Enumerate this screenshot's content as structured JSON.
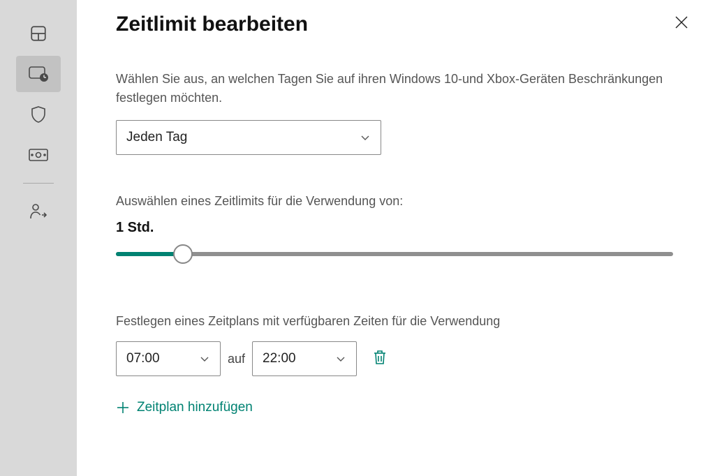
{
  "title": "Zeitlimit bearbeiten",
  "description": "Wählen Sie aus, an welchen Tagen Sie auf ihren Windows 10-und Xbox-Geräten Beschränkungen festlegen möchten.",
  "day_select": {
    "value": "Jeden Tag"
  },
  "limit_label": "Auswählen eines Zeitlimits für die Verwendung von:",
  "limit_value": "1 Std.",
  "schedule_label": "Festlegen eines Zeitplans mit verfügbaren Zeiten für die Verwendung",
  "schedule": {
    "from": "07:00",
    "sep": "auf",
    "to": "22:00"
  },
  "add_schedule": "Zeitplan hinzufügen",
  "colors": {
    "accent": "#008272"
  }
}
